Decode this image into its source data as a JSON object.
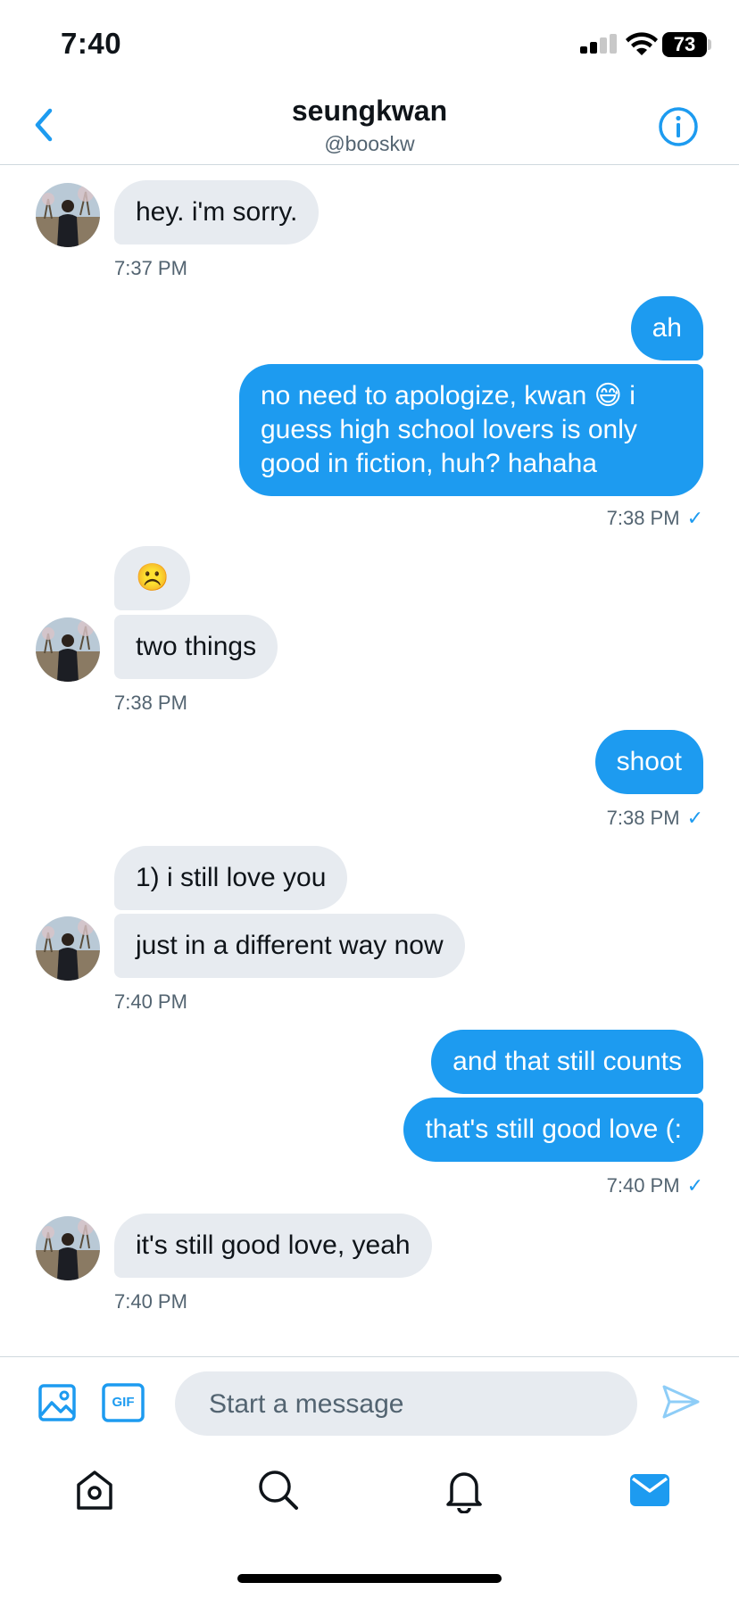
{
  "status_bar": {
    "time": "7:40",
    "battery": "73"
  },
  "header": {
    "name": "seungkwan",
    "handle": "@booskw"
  },
  "messages": [
    {
      "text": "hey. i'm sorry.",
      "time": "7:37 PM"
    },
    {
      "text": "ah"
    },
    {
      "text": "no need to apologize, kwan 😅 i",
      "line2": "guess high school lovers is only",
      "line3": "good in fiction, huh? hahaha",
      "time": "7:38 PM",
      "check": "✓"
    },
    {
      "text": "☹️"
    },
    {
      "text": "two things",
      "time": "7:38 PM"
    },
    {
      "text": "shoot",
      "time": "7:38 PM",
      "check": "✓"
    },
    {
      "text": "1) i still love you"
    },
    {
      "text": "just in a different way now",
      "time": "7:40 PM"
    },
    {
      "text": "and that still counts"
    },
    {
      "text": "that's still good love (:",
      "time": "7:40 PM",
      "check": "✓"
    },
    {
      "text": "it's still good love, yeah",
      "time": "7:40 PM"
    }
  ],
  "composer": {
    "placeholder": "Start a message",
    "gif_label": "GIF"
  },
  "colors": {
    "accent": "#1d9bf0",
    "incoming_bubble": "#e7ebf0"
  },
  "icons": [
    "chevron-left-icon",
    "info-icon",
    "image-icon",
    "gif-icon",
    "send-icon",
    "home-icon",
    "search-icon",
    "bell-icon",
    "mail-icon"
  ]
}
